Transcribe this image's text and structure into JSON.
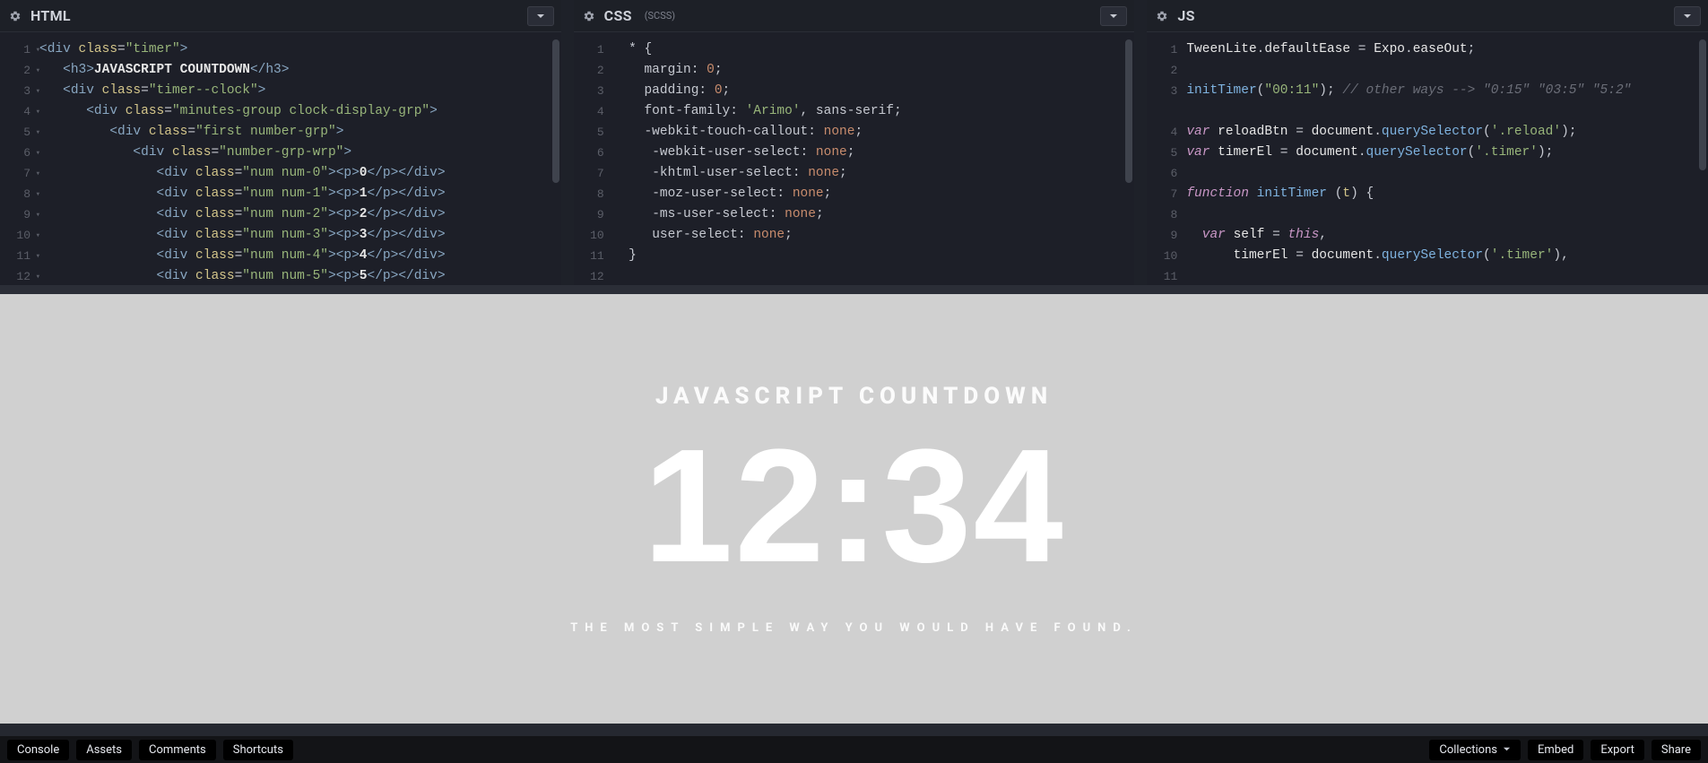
{
  "editors": {
    "html": {
      "title": "HTML",
      "subtitle": "",
      "line_count": 12,
      "fold_lines": [
        1,
        2,
        3,
        4,
        5,
        6,
        7,
        8,
        9,
        10,
        11,
        12
      ],
      "lines": [
        {
          "indent": 0,
          "type": "open",
          "tag": "div",
          "attrs": [
            [
              "class",
              "timer"
            ]
          ]
        },
        {
          "indent": 1,
          "type": "full",
          "tag": "h3",
          "text": "JAVASCRIPT COUNTDOWN"
        },
        {
          "indent": 1,
          "type": "open",
          "tag": "div",
          "attrs": [
            [
              "class",
              "timer--clock"
            ]
          ]
        },
        {
          "indent": 2,
          "type": "open",
          "tag": "div",
          "attrs": [
            [
              "class",
              "minutes-group clock-display-grp"
            ]
          ]
        },
        {
          "indent": 3,
          "type": "open",
          "tag": "div",
          "attrs": [
            [
              "class",
              "first number-grp"
            ]
          ]
        },
        {
          "indent": 4,
          "type": "open",
          "tag": "div",
          "attrs": [
            [
              "class",
              "number-grp-wrp"
            ]
          ]
        },
        {
          "indent": 5,
          "type": "num",
          "cls": "num num-0",
          "n": "0"
        },
        {
          "indent": 5,
          "type": "num",
          "cls": "num num-1",
          "n": "1"
        },
        {
          "indent": 5,
          "type": "num",
          "cls": "num num-2",
          "n": "2"
        },
        {
          "indent": 5,
          "type": "num",
          "cls": "num num-3",
          "n": "3"
        },
        {
          "indent": 5,
          "type": "num",
          "cls": "num num-4",
          "n": "4"
        },
        {
          "indent": 5,
          "type": "num",
          "cls": "num num-5",
          "n": "5"
        }
      ]
    },
    "css": {
      "title": "CSS",
      "subtitle": "(SCSS)",
      "line_count": 12,
      "lines_raw": [
        "* {",
        "  margin: 0;",
        "  padding: 0;",
        "  font-family: 'Arimo', sans-serif;",
        "  -webkit-touch-callout: none;",
        "   -webkit-user-select: none;",
        "   -khtml-user-select: none;",
        "   -moz-user-select: none;",
        "   -ms-user-select: none;",
        "   user-select: none;",
        "}",
        ""
      ]
    },
    "js": {
      "title": "JS",
      "subtitle": "",
      "line_count": 11,
      "lines_js": [
        [
          "obj",
          "TweenLite",
          ".",
          "obj",
          "defaultEase",
          " ",
          "op",
          "=",
          " ",
          "obj",
          "Expo",
          ".",
          "obj",
          "easeOut",
          "punct",
          ";"
        ],
        [],
        [
          "fn",
          "initTimer",
          "punct",
          "(",
          "str",
          "\"00:11\"",
          "punct",
          ")",
          "punct",
          ";",
          " ",
          "com",
          "// other ways --> \"0:15\" \"03:5\" \"5:2\""
        ],
        [],
        [
          "kw",
          "var",
          " ",
          "obj",
          "reloadBtn",
          " ",
          "op",
          "=",
          " ",
          "obj",
          "document",
          ".",
          "fn",
          "querySelector",
          "punct",
          "(",
          "str",
          "'.reload'",
          "punct",
          ")",
          "punct",
          ";"
        ],
        [
          "kw",
          "var",
          " ",
          "obj",
          "timerEl",
          " ",
          "op",
          "=",
          " ",
          "obj",
          "document",
          ".",
          "fn",
          "querySelector",
          "punct",
          "(",
          "str",
          "'.timer'",
          "punct",
          ")",
          "punct",
          ";"
        ],
        [],
        [
          "kw",
          "function",
          " ",
          "fn",
          "initTimer",
          " ",
          "punct",
          "(",
          "par",
          "t",
          "punct",
          ")",
          " ",
          "punct",
          "{"
        ],
        [],
        [
          "  ",
          "kw",
          "var",
          " ",
          "obj",
          "self",
          " ",
          "op",
          "=",
          " ",
          "kw",
          "this",
          "punct",
          ","
        ],
        [
          "      ",
          "obj",
          "timerEl",
          " ",
          "op",
          "=",
          " ",
          "obj",
          "document",
          ".",
          "fn",
          "querySelector",
          "punct",
          "(",
          "str",
          "'.timer'",
          "punct",
          ")",
          "punct",
          ","
        ]
      ],
      "wrap_line_3_extra_visual_line": true
    }
  },
  "preview": {
    "title": "JAVASCRIPT COUNTDOWN",
    "clock": "12:34",
    "subtitle": "THE MOST SIMPLE WAY YOU WOULD HAVE FOUND."
  },
  "bottombar": {
    "left": [
      "Console",
      "Assets",
      "Comments",
      "Shortcuts"
    ],
    "right": [
      {
        "label": "Collections",
        "dropdown": true
      },
      {
        "label": "Embed"
      },
      {
        "label": "Export"
      },
      {
        "label": "Share"
      }
    ]
  }
}
